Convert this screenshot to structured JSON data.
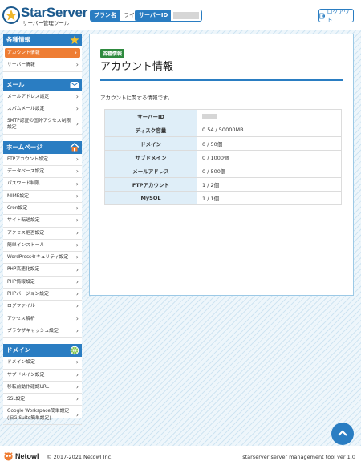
{
  "header": {
    "logo_title": "StarServer",
    "logo_subtitle": "サーバー管理ツール",
    "plan": {
      "label": "プラン名",
      "value": "ライト"
    },
    "server": {
      "label": "サーバーID",
      "value": ""
    },
    "logout_label": "ログアウト"
  },
  "sidebar": {
    "sections": [
      {
        "title": "各種情報",
        "icon": "star-icon",
        "items": [
          {
            "label": "アカウント情報",
            "active": true
          },
          {
            "label": "サーバー情報"
          }
        ]
      },
      {
        "title": "メール",
        "icon": "mail-icon",
        "items": [
          {
            "label": "メールアドレス設定"
          },
          {
            "label": "スパムメール設定"
          },
          {
            "label": "SMTP認証の国外アクセス制限設定"
          }
        ]
      },
      {
        "title": "ホームページ",
        "icon": "home-icon",
        "items": [
          {
            "label": "FTPアカウント設定"
          },
          {
            "label": "データベース設定"
          },
          {
            "label": "パスワード制限"
          },
          {
            "label": "MIME設定"
          },
          {
            "label": "Cron設定"
          },
          {
            "label": "サイト転送設定"
          },
          {
            "label": "アクセス拒否設定"
          },
          {
            "label": "簡単インストール"
          },
          {
            "label": "WordPressセキュリティ設定"
          },
          {
            "label": "PHP高速化設定"
          },
          {
            "label": "PHP情報設定"
          },
          {
            "label": "PHPバージョン設定"
          },
          {
            "label": "ログファイル"
          },
          {
            "label": "アクセス解析"
          },
          {
            "label": "ブラウザキャッシュ設定"
          }
        ]
      },
      {
        "title": "ドメイン",
        "icon": "globe-icon",
        "items": [
          {
            "label": "ドメイン設定"
          },
          {
            "label": "サブドメイン設定"
          },
          {
            "label": "移転前動作確認URL"
          },
          {
            "label": "SSL設定"
          },
          {
            "label": "Google Workspace簡単設定 (旧G Suite簡単設定)"
          }
        ]
      }
    ]
  },
  "main": {
    "badge": "各種情報",
    "title": "アカウント情報",
    "description": "アカウントに関する情報です。",
    "rows": [
      {
        "label": "サーバーID",
        "value": ""
      },
      {
        "label": "ディスク容量",
        "value": "0.54 / 50000MB"
      },
      {
        "label": "ドメイン",
        "value": "0 / 50個"
      },
      {
        "label": "サブドメイン",
        "value": "0 / 1000個"
      },
      {
        "label": "メールアドレス",
        "value": "0 / 500個"
      },
      {
        "label": "FTPアカウント",
        "value": "1 / 2個"
      },
      {
        "label": "MySQL",
        "value": "1 / 1個"
      }
    ]
  },
  "footer": {
    "brand": "Netowl",
    "copyright": "© 2017-2021 Netowl Inc.",
    "tool": "starserver server management tool ver 1.0"
  },
  "colors": {
    "primary": "#2a7dc2",
    "active": "#ee7d34",
    "badge": "#2e8a3e"
  }
}
